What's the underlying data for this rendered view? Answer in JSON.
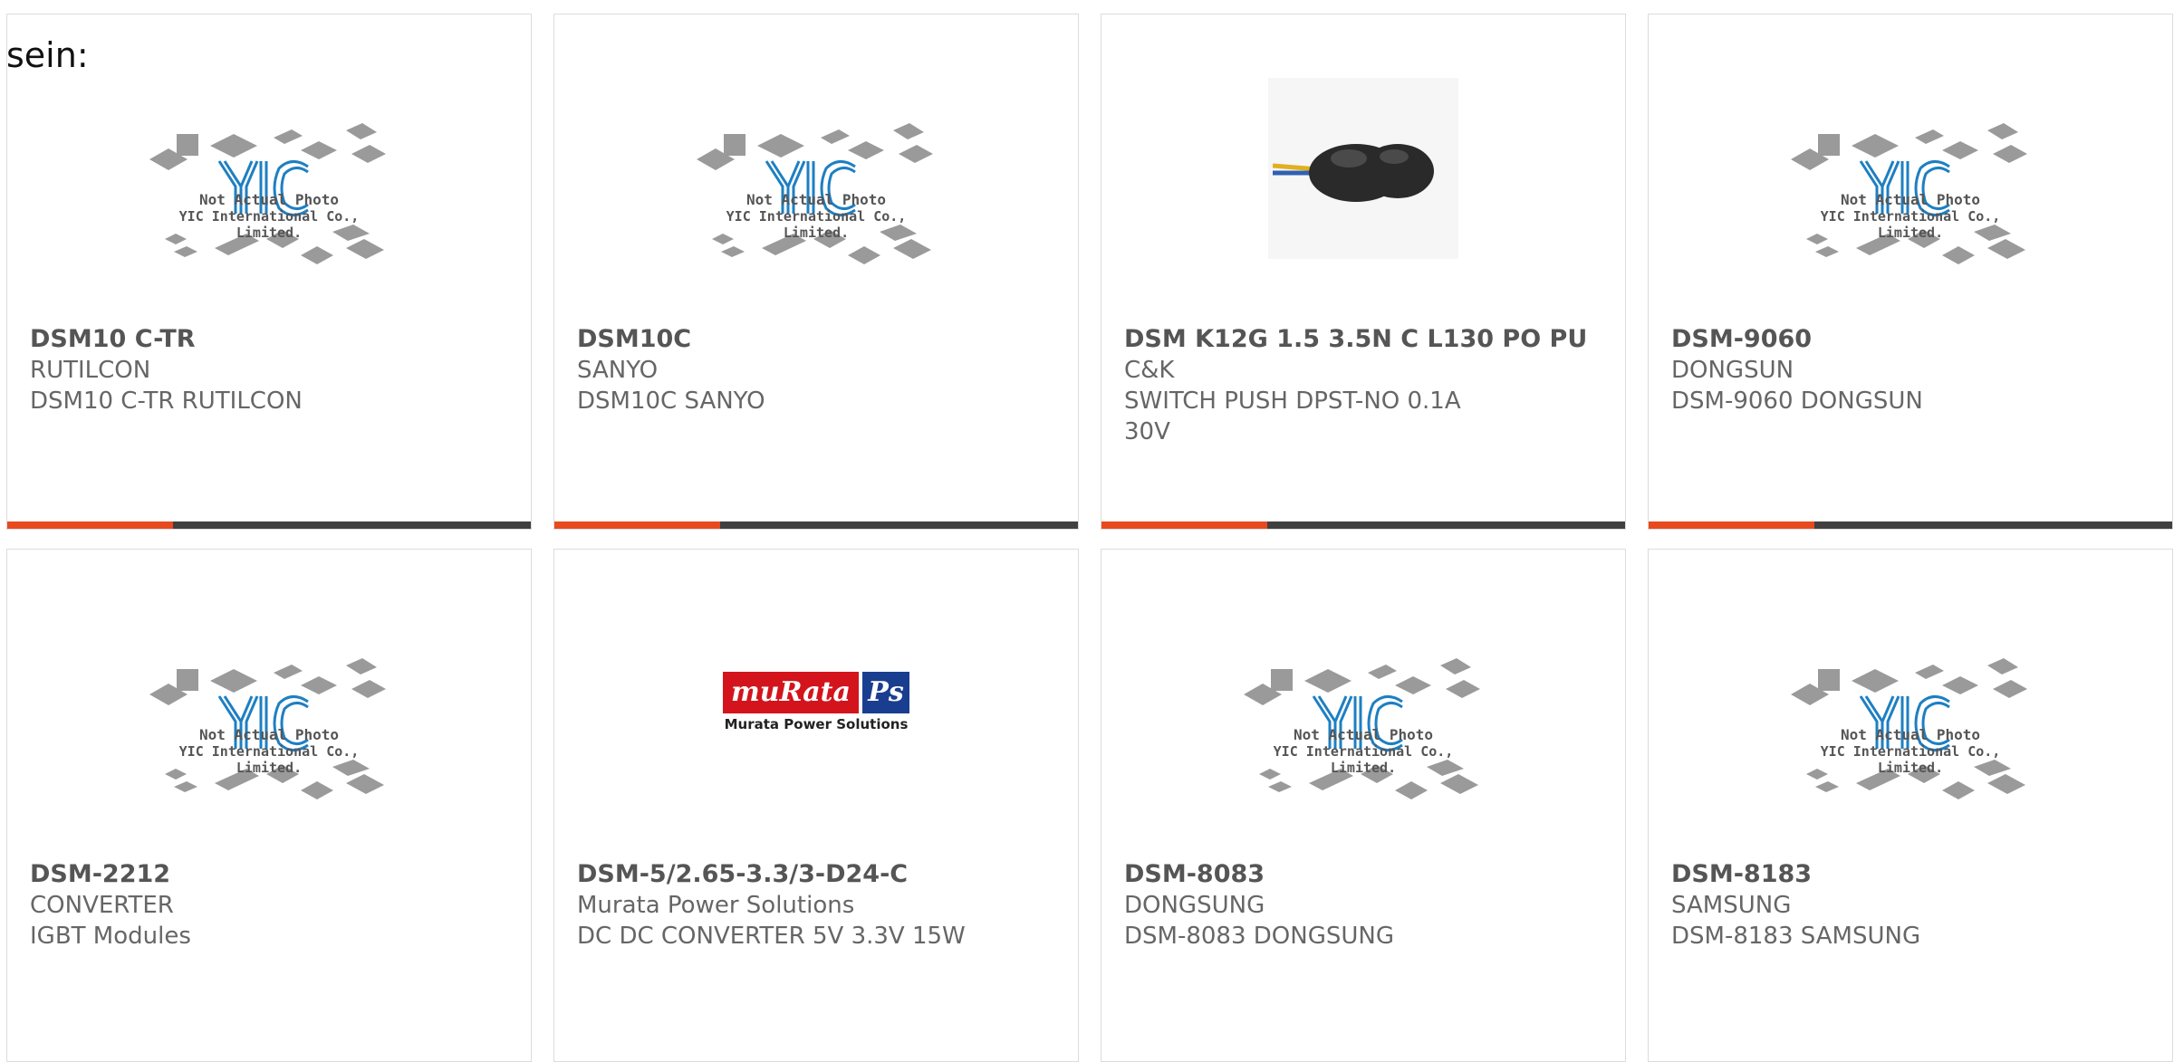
{
  "page_prefix": "sein:",
  "placeholder": {
    "line1": "Not Actual Photo",
    "line2": "YIC International Co., Limited."
  },
  "murata_logo": {
    "brand": "muRata",
    "mark": "Ps",
    "sub": "Murata Power Solutions"
  },
  "colors": {
    "accent": "#e84a1f",
    "bar": "#404040",
    "yic_blue": "#1e7fc2",
    "murata_red": "#d3141c",
    "murata_blue": "#1a3e8f"
  },
  "products": [
    {
      "part": "DSM10 C-TR",
      "maker": "RUTILCON",
      "desc": "DSM10 C-TR RUTILCON",
      "image": "yic-placeholder"
    },
    {
      "part": "DSM10C",
      "maker": "SANYO",
      "desc": "DSM10C SANYO",
      "image": "yic-placeholder"
    },
    {
      "part": "DSM K12G 1.5 3.5N C L130 PO PU",
      "maker": "C&K",
      "desc": "SWITCH PUSH DPST-NO 0.1A 30V",
      "image": "switch-photo"
    },
    {
      "part": "DSM-9060",
      "maker": "DONGSUN",
      "desc": "DSM-9060 DONGSUN",
      "image": "yic-placeholder"
    },
    {
      "part": "DSM-2212",
      "maker": "CONVERTER",
      "desc": "IGBT Modules",
      "image": "yic-placeholder"
    },
    {
      "part": "DSM-5/2.65-3.3/3-D24-C",
      "maker": "Murata Power Solutions",
      "desc": "DC DC CONVERTER 5V 3.3V 15W",
      "image": "murata-logo"
    },
    {
      "part": "DSM-8083",
      "maker": "DONGSUNG",
      "desc": "DSM-8083 DONGSUNG",
      "image": "yic-placeholder"
    },
    {
      "part": "DSM-8183",
      "maker": "SAMSUNG",
      "desc": "DSM-8183 SAMSUNG",
      "image": "yic-placeholder"
    }
  ]
}
